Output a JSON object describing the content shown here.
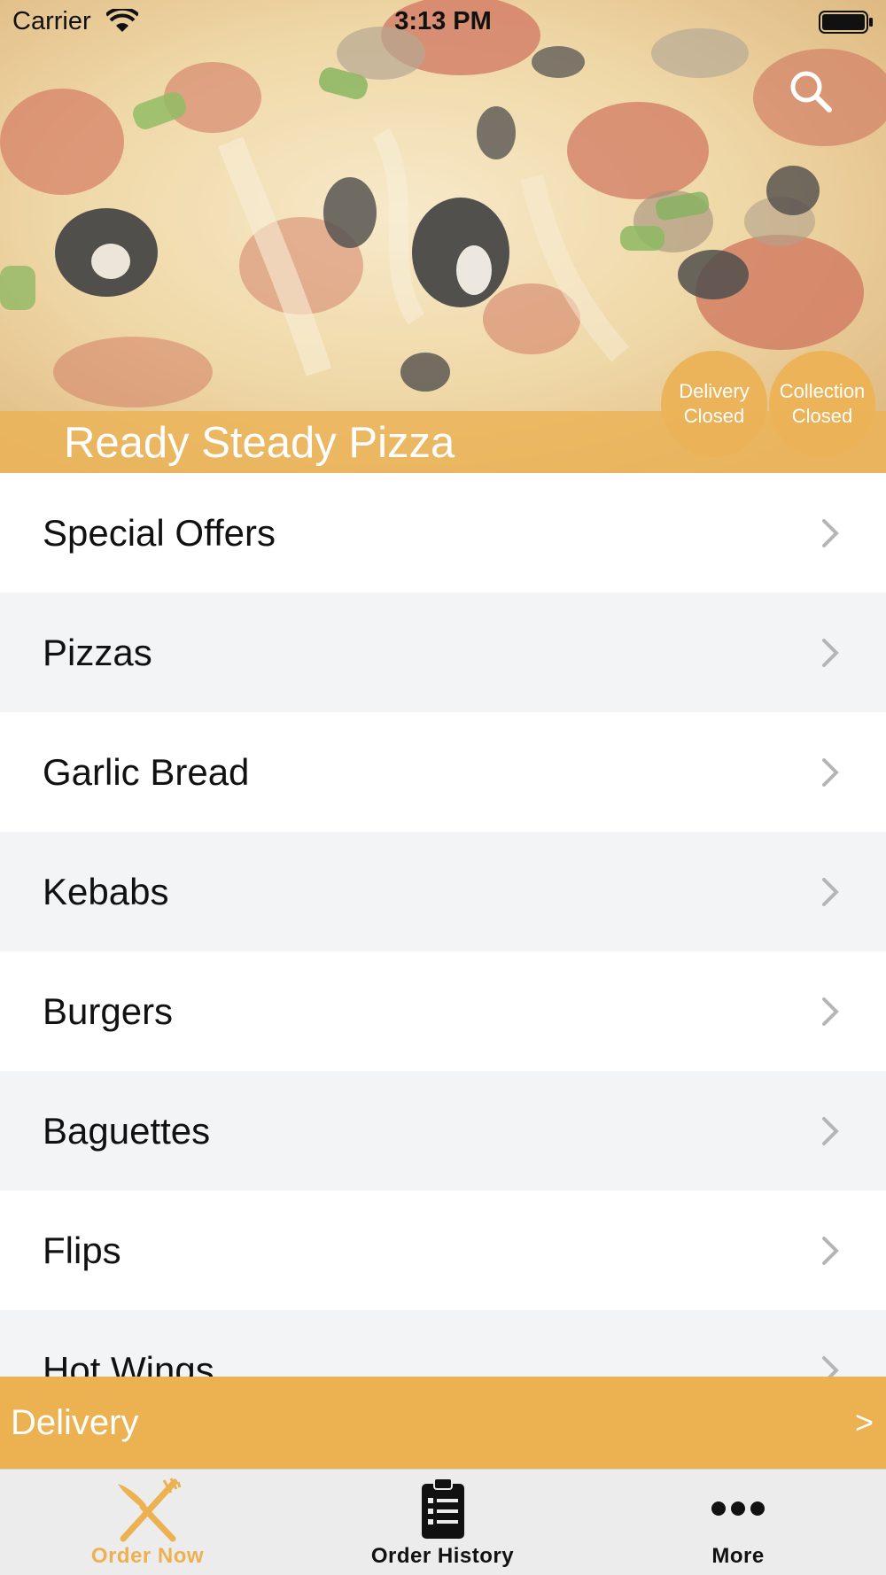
{
  "status_bar": {
    "carrier": "Carrier",
    "time": "3:13 PM",
    "wifi_icon": "wifi-icon",
    "battery_icon": "battery-full-icon"
  },
  "header": {
    "restaurant_name": "Ready Steady Pizza",
    "search_icon": "search-icon",
    "delivery_status": {
      "line1": "Delivery",
      "line2": "Closed"
    },
    "collection_status": {
      "line1": "Collection",
      "line2": "Closed"
    }
  },
  "menu": {
    "categories": [
      {
        "label": "Special Offers"
      },
      {
        "label": "Pizzas"
      },
      {
        "label": "Garlic Bread"
      },
      {
        "label": "Kebabs"
      },
      {
        "label": "Burgers"
      },
      {
        "label": "Baguettes"
      },
      {
        "label": "Flips"
      },
      {
        "label": "Hot Wings"
      }
    ],
    "chevron_icon": "chevron-right-icon"
  },
  "order_bar": {
    "mode_label": "Delivery",
    "arrow": ">"
  },
  "tabs": [
    {
      "label": "Order Now",
      "icon": "fork-knife-icon",
      "active": true
    },
    {
      "label": "Order History",
      "icon": "clipboard-list-icon",
      "active": false
    },
    {
      "label": "More",
      "icon": "more-dots-icon",
      "active": false
    }
  ],
  "colors": {
    "accent": "#ecb151",
    "row_alt": "#f3f4f6",
    "tab_bar": "#ececec"
  }
}
